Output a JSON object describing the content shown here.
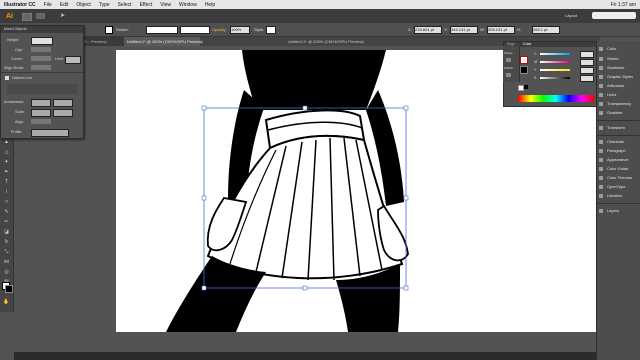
{
  "menubar": {
    "apple": "",
    "app_name": "Illustrator CC",
    "items": [
      "File",
      "Edit",
      "Object",
      "Type",
      "Select",
      "Effect",
      "View",
      "Window",
      "Help"
    ],
    "clock": "Fri 1:37 am"
  },
  "appbar": {
    "logo": "Ai",
    "workspace": "Layout"
  },
  "controlbar": {
    "selection_label": "Mixed Objects",
    "stroke_label": "Stroke:",
    "opacity_label": "Opacity:",
    "opacity_value": "100%",
    "style_label": "Style:",
    "x_label": "X:",
    "x_value": "218.824 pt",
    "y_label": "Y:",
    "y_value": "344.131 pt",
    "w_label": "W:",
    "w_value": "305.131 pt",
    "h_label": "H:",
    "h_value": "269.1 pt"
  },
  "tabs": [
    {
      "label": "Pl... Preview)"
    },
    {
      "label": "Untitled-1* @ 200% (CMYK/GPU Preview)"
    }
  ],
  "window_title": "Untitled-1* @ 200% (CMYK/GPU Preview)",
  "stroke_panel": {
    "header": "Mixed Objects",
    "weight_label": "Weight:",
    "cap_label": "Cap:",
    "corner_label": "Corner:",
    "limit_label": "Limit:",
    "align_label": "Align Stroke:",
    "dashed_label": "Dashed Line",
    "arrowheads_label": "Arrowheads:",
    "scale_label": "Scale:",
    "align2_label": "Align:",
    "profile_label": "Profile:"
  },
  "color_panel": {
    "tabs": [
      "Align",
      "Color"
    ],
    "side_labels": [
      "Shape",
      "Pathfin"
    ],
    "channel_labels": [
      "C",
      "M",
      "Y",
      "K"
    ]
  },
  "dock": {
    "items": [
      "Color",
      "Stroke",
      "Swatches",
      "Graphic Styles",
      "Artboards",
      "Links",
      "Transparency",
      "Gradient",
      "Transform",
      "Character",
      "Paragraph",
      "Appearance",
      "Color Guide",
      "Color Themes",
      "OpenType",
      "Libraries",
      "Layers"
    ]
  },
  "colors": {
    "accent": "#ff9a00",
    "ui_bg": "#535353",
    "artboard": "#ffffff"
  }
}
